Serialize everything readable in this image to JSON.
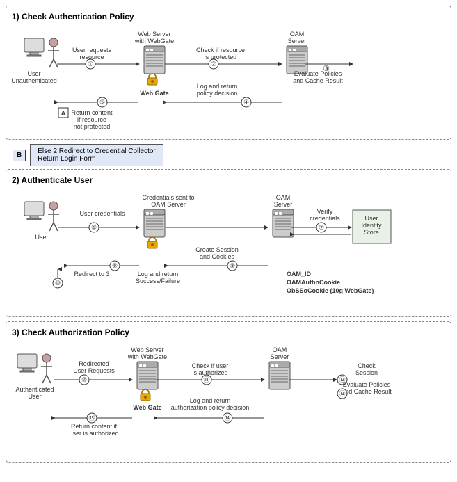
{
  "sections": [
    {
      "id": "section1",
      "title": "1) Check Authentication Policy",
      "actors": {
        "user": "User\nUnauthenticated",
        "webserver": "Web Server\nwith WebGate",
        "oam": "OAM\nServer"
      },
      "steps": [
        {
          "num": "1",
          "label": "User requests\nresource",
          "dir": "right"
        },
        {
          "num": "2",
          "label": "Check if resource\nis protected",
          "dir": "right"
        },
        {
          "num": "3",
          "label": "Evaluate Policies\nand Cache Result",
          "dir": "right"
        },
        {
          "num": "4",
          "label": "Log and return\npolicy decision",
          "dir": "left"
        },
        {
          "num": "5",
          "label": "",
          "dir": "left"
        }
      ],
      "nodeLabels": [
        "Web Gate"
      ],
      "connectors": [
        {
          "label": "A",
          "text": "Return content\nif resource\nnot protected"
        }
      ]
    },
    {
      "id": "section1b",
      "label": "B",
      "text": "Else 2 Redirect to Credential Collector\nReturn Login Form"
    },
    {
      "id": "section2",
      "title": "2) Authenticate User",
      "steps": [
        {
          "num": "6",
          "label": "User credentials",
          "dir": "right"
        },
        {
          "num": "7",
          "label": "Verify\ncredentials",
          "dir": "right"
        },
        {
          "num": "8",
          "label": "Create Session\nand Cookies",
          "dir": "left"
        },
        {
          "num": "9",
          "label": "",
          "dir": "left"
        },
        {
          "num": "10",
          "label": "Redirect to 3",
          "dir": "left"
        }
      ],
      "actors": {
        "user": "User",
        "webserver": "Credentials sent to\nOAM Server",
        "oam": "OAM\nServer",
        "store": "User\nIdentity\nStore"
      },
      "cookies": {
        "label": "OAM_ID",
        "items": [
          "OAMAuthnCookie",
          "ObSSoCookie (10g WebGate)"
        ]
      }
    },
    {
      "id": "section3",
      "title": "3) Check Authorization Policy",
      "steps": [
        {
          "num": "10",
          "label": "Redirected\nUser Requests",
          "dir": "right"
        },
        {
          "num": "11",
          "label": "Check if user\nis authorized",
          "dir": "right"
        },
        {
          "num": "12",
          "label": "Check\nSession",
          "dir": "right"
        },
        {
          "num": "13",
          "label": "Evaluate Policies\nand Cache Result",
          "dir": "right"
        },
        {
          "num": "14",
          "label": "Log and return\nauthorization policy decision",
          "dir": "left"
        },
        {
          "num": "15",
          "label": "Return content if\nuser is authorized",
          "dir": "left"
        }
      ],
      "actors": {
        "user": "Authenticated\nUser",
        "webserver": "Web Server\nwith WebGate",
        "oam": "OAM\nServer"
      },
      "nodeLabels": [
        "Web Gate"
      ]
    }
  ]
}
